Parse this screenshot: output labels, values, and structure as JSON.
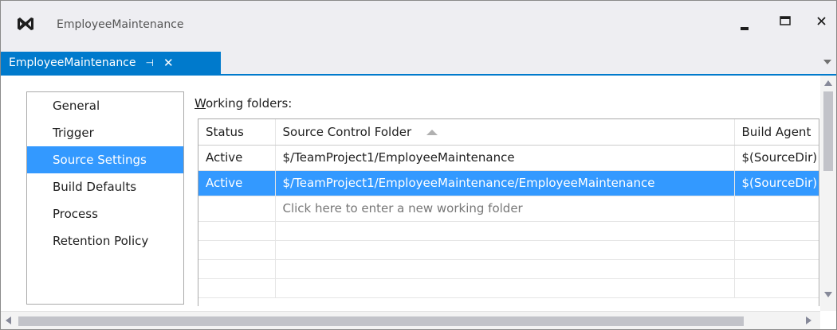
{
  "window": {
    "title": "EmployeeMaintenance"
  },
  "tab": {
    "label": "EmployeeMaintenance",
    "pin_glyph": "⊣",
    "close_glyph": "✕"
  },
  "nav": {
    "items": [
      {
        "label": "General"
      },
      {
        "label": "Trigger"
      },
      {
        "label": "Source Settings",
        "selected": true
      },
      {
        "label": "Build Defaults"
      },
      {
        "label": "Process"
      },
      {
        "label": "Retention Policy"
      }
    ]
  },
  "working_folders": {
    "label_prefix": "W",
    "label_rest": "orking folders:",
    "columns": [
      "Status",
      "Source Control Folder",
      "Build Agent"
    ],
    "rows": [
      {
        "status": "Active",
        "folder": "$/TeamProject1/EmployeeMaintenance",
        "agent": "$(SourceDir)"
      },
      {
        "status": "Active",
        "folder": "$/TeamProject1/EmployeeMaintenance/EmployeeMaintenance",
        "agent": "$(SourceDir)",
        "selected": true
      }
    ],
    "new_row_placeholder": "Click here to enter a new working folder"
  },
  "colors": {
    "accent": "#007acc",
    "selection": "#3399ff"
  }
}
